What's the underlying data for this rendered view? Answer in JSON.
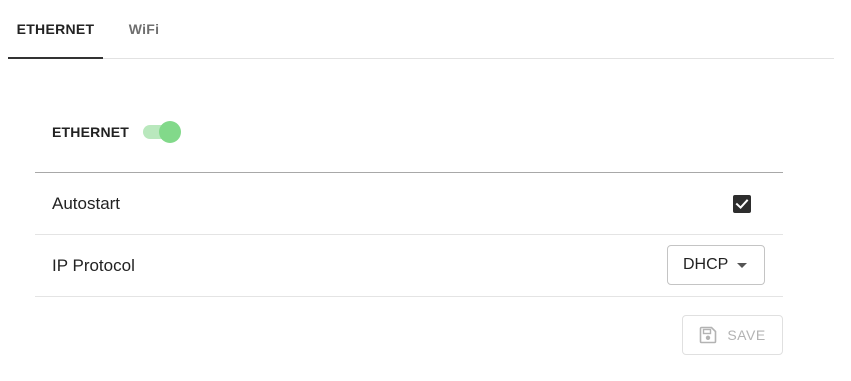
{
  "tabs": [
    {
      "label": "ETHERNET",
      "active": true
    },
    {
      "label": "WiFi",
      "active": false
    }
  ],
  "ethernet_section": {
    "title": "ETHERNET",
    "enabled": true
  },
  "settings": {
    "autostart": {
      "label": "Autostart",
      "checked": true,
      "icon": "check-icon"
    },
    "ip_protocol": {
      "label": "IP Protocol",
      "selected": "DHCP",
      "icon": "caret-down-icon"
    }
  },
  "actions": {
    "save_label": "SAVE",
    "save_icon": "floppy-disk-icon",
    "save_disabled": true
  },
  "colors": {
    "switch_track": "#b9e8bd",
    "switch_thumb": "#82d98a",
    "checkbox_fill": "#2d2d2d",
    "disabled_text": "#b3b3b3"
  }
}
